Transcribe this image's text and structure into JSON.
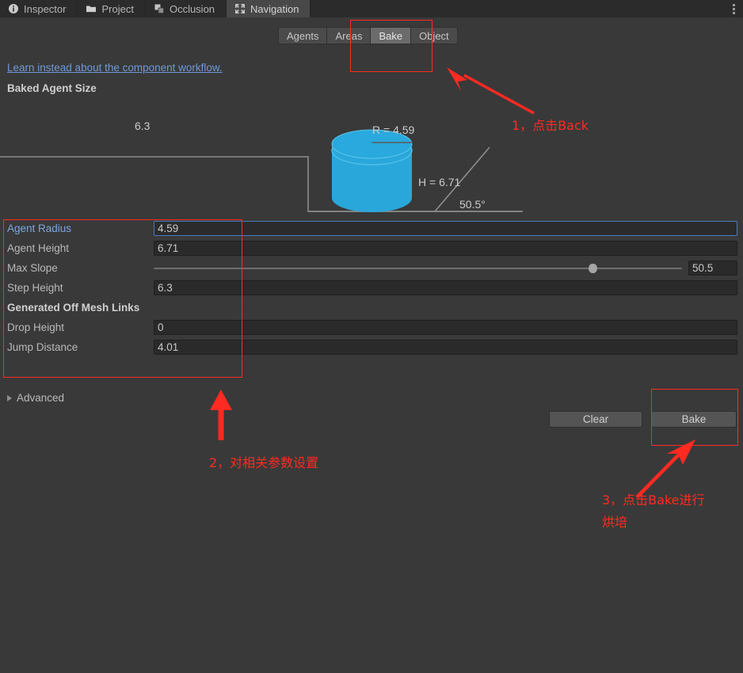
{
  "window": {
    "tabs": [
      {
        "label": "Inspector",
        "icon": "info-icon",
        "active": false
      },
      {
        "label": "Project",
        "icon": "folder-icon",
        "active": false
      },
      {
        "label": "Occlusion",
        "icon": "occlusion-icon",
        "active": false
      },
      {
        "label": "Navigation",
        "icon": "navigation-icon",
        "active": true
      }
    ],
    "menu_icon": "kebab-menu-icon"
  },
  "toolbar": {
    "buttons": [
      {
        "label": "Agents",
        "selected": false
      },
      {
        "label": "Areas",
        "selected": false
      },
      {
        "label": "Bake",
        "selected": true
      },
      {
        "label": "Object",
        "selected": false
      }
    ]
  },
  "header": {
    "link": "Learn instead about the component workflow.",
    "section_title": "Baked Agent Size"
  },
  "diagram": {
    "radius_label": "R = 4.59",
    "height_label": "H = 6.71",
    "slope_label": "50.5°",
    "step_label": "6.3",
    "cylinder_color": "#2aa7da",
    "line_color": "#9a9a9a"
  },
  "properties": [
    {
      "label": "Agent Radius",
      "value": "4.59",
      "type": "float",
      "focused": true
    },
    {
      "label": "Agent Height",
      "value": "6.71",
      "type": "float",
      "focused": false
    },
    {
      "label": "Max Slope",
      "value": "50.5",
      "type": "slider",
      "slider_percent": 83
    },
    {
      "label": "Step Height",
      "value": "6.3",
      "type": "float",
      "focused": false
    }
  ],
  "offmesh": {
    "section_title": "Generated Off Mesh Links",
    "properties": [
      {
        "label": "Drop Height",
        "value": "0",
        "type": "float"
      },
      {
        "label": "Jump Distance",
        "value": "4.01",
        "type": "float"
      }
    ]
  },
  "advanced": {
    "label": "Advanced",
    "expanded": false
  },
  "actions": {
    "clear_label": "Clear",
    "bake_label": "Bake"
  },
  "annotations": {
    "color": "#ff2a22",
    "step1": "1，点击Back",
    "step2": "2，对相关参数设置",
    "step3_line1": "3，点击Bake进行",
    "step3_line2": "烘培"
  }
}
